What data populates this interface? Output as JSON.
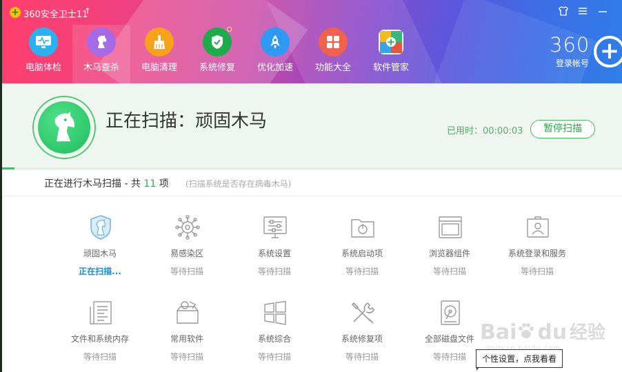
{
  "window": {
    "title": "360安全卫士11",
    "skin_icon": "shirt-icon",
    "menu_icon": "menu-icon",
    "minimize_icon": "minimize-icon"
  },
  "nav": {
    "items": [
      {
        "label": "电脑体检",
        "icon": "monitor-icon",
        "color": "#2ab2f0"
      },
      {
        "label": "木马查杀",
        "icon": "horse-icon",
        "color": "#a76ae6"
      },
      {
        "label": "电脑清理",
        "icon": "broom-icon",
        "color": "#f7a21a"
      },
      {
        "label": "系统修复",
        "icon": "shield-icon",
        "color": "#1eab4c"
      },
      {
        "label": "优化加速",
        "icon": "rocket-icon",
        "color": "#2f98f2"
      },
      {
        "label": "功能大全",
        "icon": "grid-icon",
        "color": "#f1624e"
      },
      {
        "label": "软件管家",
        "icon": "apps-icon",
        "color": "#42bb7c"
      }
    ],
    "active_index": 1
  },
  "account": {
    "brand": "360",
    "login_label": "登录帐号"
  },
  "scan": {
    "title": "正在扫描：顽固木马",
    "elapsed": "已用时：00:00:03",
    "pause_label": "暂停扫描",
    "progress_fraction": 0.02
  },
  "status": {
    "prefix": "正在进行木马扫描 - 共",
    "count": "11",
    "suffix": "项",
    "hint": "(扫描系统是否存在病毒木马)"
  },
  "scan_items": [
    {
      "label": "顽固木马",
      "status": "正在扫描...",
      "icon": "shield-horse-icon",
      "active": true
    },
    {
      "label": "易感染区",
      "status": "等待扫描",
      "icon": "virus-icon",
      "active": false
    },
    {
      "label": "系统设置",
      "status": "等待扫描",
      "icon": "settings-monitor-icon",
      "active": false
    },
    {
      "label": "系统启动项",
      "status": "等待扫描",
      "icon": "startup-folder-icon",
      "active": false
    },
    {
      "label": "浏览器组件",
      "status": "等待扫描",
      "icon": "browser-window-icon",
      "active": false
    },
    {
      "label": "系统登录和服务",
      "status": "等待扫描",
      "icon": "user-card-icon",
      "active": false
    },
    {
      "label": "文件和系统内存",
      "status": "等待扫描",
      "icon": "document-icon",
      "active": false
    },
    {
      "label": "常用软件",
      "status": "等待扫描",
      "icon": "software-box-icon",
      "active": false
    },
    {
      "label": "系统综合",
      "status": "等待扫描",
      "icon": "windows-icon",
      "active": false
    },
    {
      "label": "系统修复项",
      "status": "等待扫描",
      "icon": "tools-icon",
      "active": false
    },
    {
      "label": "全部磁盘文件",
      "status": "等待扫描",
      "icon": "hard-disk-icon",
      "active": false
    }
  ],
  "watermark": {
    "text": "Bai",
    "text2": "du",
    "jingyan": "经验",
    "sub": "jingyan.baidu.com"
  },
  "tooltip": "个性设置，点我看看"
}
